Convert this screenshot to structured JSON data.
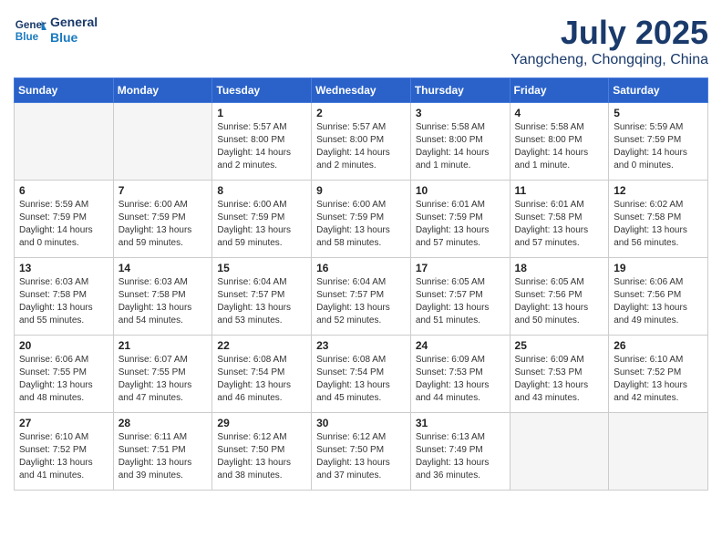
{
  "header": {
    "logo_general": "General",
    "logo_blue": "Blue",
    "month_year": "July 2025",
    "location": "Yangcheng, Chongqing, China"
  },
  "weekdays": [
    "Sunday",
    "Monday",
    "Tuesday",
    "Wednesday",
    "Thursday",
    "Friday",
    "Saturday"
  ],
  "weeks": [
    [
      {
        "day": "",
        "info": ""
      },
      {
        "day": "",
        "info": ""
      },
      {
        "day": "1",
        "info": "Sunrise: 5:57 AM\nSunset: 8:00 PM\nDaylight: 14 hours\nand 2 minutes."
      },
      {
        "day": "2",
        "info": "Sunrise: 5:57 AM\nSunset: 8:00 PM\nDaylight: 14 hours\nand 2 minutes."
      },
      {
        "day": "3",
        "info": "Sunrise: 5:58 AM\nSunset: 8:00 PM\nDaylight: 14 hours\nand 1 minute."
      },
      {
        "day": "4",
        "info": "Sunrise: 5:58 AM\nSunset: 8:00 PM\nDaylight: 14 hours\nand 1 minute."
      },
      {
        "day": "5",
        "info": "Sunrise: 5:59 AM\nSunset: 7:59 PM\nDaylight: 14 hours\nand 0 minutes."
      }
    ],
    [
      {
        "day": "6",
        "info": "Sunrise: 5:59 AM\nSunset: 7:59 PM\nDaylight: 14 hours\nand 0 minutes."
      },
      {
        "day": "7",
        "info": "Sunrise: 6:00 AM\nSunset: 7:59 PM\nDaylight: 13 hours\nand 59 minutes."
      },
      {
        "day": "8",
        "info": "Sunrise: 6:00 AM\nSunset: 7:59 PM\nDaylight: 13 hours\nand 59 minutes."
      },
      {
        "day": "9",
        "info": "Sunrise: 6:00 AM\nSunset: 7:59 PM\nDaylight: 13 hours\nand 58 minutes."
      },
      {
        "day": "10",
        "info": "Sunrise: 6:01 AM\nSunset: 7:59 PM\nDaylight: 13 hours\nand 57 minutes."
      },
      {
        "day": "11",
        "info": "Sunrise: 6:01 AM\nSunset: 7:58 PM\nDaylight: 13 hours\nand 57 minutes."
      },
      {
        "day": "12",
        "info": "Sunrise: 6:02 AM\nSunset: 7:58 PM\nDaylight: 13 hours\nand 56 minutes."
      }
    ],
    [
      {
        "day": "13",
        "info": "Sunrise: 6:03 AM\nSunset: 7:58 PM\nDaylight: 13 hours\nand 55 minutes."
      },
      {
        "day": "14",
        "info": "Sunrise: 6:03 AM\nSunset: 7:58 PM\nDaylight: 13 hours\nand 54 minutes."
      },
      {
        "day": "15",
        "info": "Sunrise: 6:04 AM\nSunset: 7:57 PM\nDaylight: 13 hours\nand 53 minutes."
      },
      {
        "day": "16",
        "info": "Sunrise: 6:04 AM\nSunset: 7:57 PM\nDaylight: 13 hours\nand 52 minutes."
      },
      {
        "day": "17",
        "info": "Sunrise: 6:05 AM\nSunset: 7:57 PM\nDaylight: 13 hours\nand 51 minutes."
      },
      {
        "day": "18",
        "info": "Sunrise: 6:05 AM\nSunset: 7:56 PM\nDaylight: 13 hours\nand 50 minutes."
      },
      {
        "day": "19",
        "info": "Sunrise: 6:06 AM\nSunset: 7:56 PM\nDaylight: 13 hours\nand 49 minutes."
      }
    ],
    [
      {
        "day": "20",
        "info": "Sunrise: 6:06 AM\nSunset: 7:55 PM\nDaylight: 13 hours\nand 48 minutes."
      },
      {
        "day": "21",
        "info": "Sunrise: 6:07 AM\nSunset: 7:55 PM\nDaylight: 13 hours\nand 47 minutes."
      },
      {
        "day": "22",
        "info": "Sunrise: 6:08 AM\nSunset: 7:54 PM\nDaylight: 13 hours\nand 46 minutes."
      },
      {
        "day": "23",
        "info": "Sunrise: 6:08 AM\nSunset: 7:54 PM\nDaylight: 13 hours\nand 45 minutes."
      },
      {
        "day": "24",
        "info": "Sunrise: 6:09 AM\nSunset: 7:53 PM\nDaylight: 13 hours\nand 44 minutes."
      },
      {
        "day": "25",
        "info": "Sunrise: 6:09 AM\nSunset: 7:53 PM\nDaylight: 13 hours\nand 43 minutes."
      },
      {
        "day": "26",
        "info": "Sunrise: 6:10 AM\nSunset: 7:52 PM\nDaylight: 13 hours\nand 42 minutes."
      }
    ],
    [
      {
        "day": "27",
        "info": "Sunrise: 6:10 AM\nSunset: 7:52 PM\nDaylight: 13 hours\nand 41 minutes."
      },
      {
        "day": "28",
        "info": "Sunrise: 6:11 AM\nSunset: 7:51 PM\nDaylight: 13 hours\nand 39 minutes."
      },
      {
        "day": "29",
        "info": "Sunrise: 6:12 AM\nSunset: 7:50 PM\nDaylight: 13 hours\nand 38 minutes."
      },
      {
        "day": "30",
        "info": "Sunrise: 6:12 AM\nSunset: 7:50 PM\nDaylight: 13 hours\nand 37 minutes."
      },
      {
        "day": "31",
        "info": "Sunrise: 6:13 AM\nSunset: 7:49 PM\nDaylight: 13 hours\nand 36 minutes."
      },
      {
        "day": "",
        "info": ""
      },
      {
        "day": "",
        "info": ""
      }
    ]
  ]
}
